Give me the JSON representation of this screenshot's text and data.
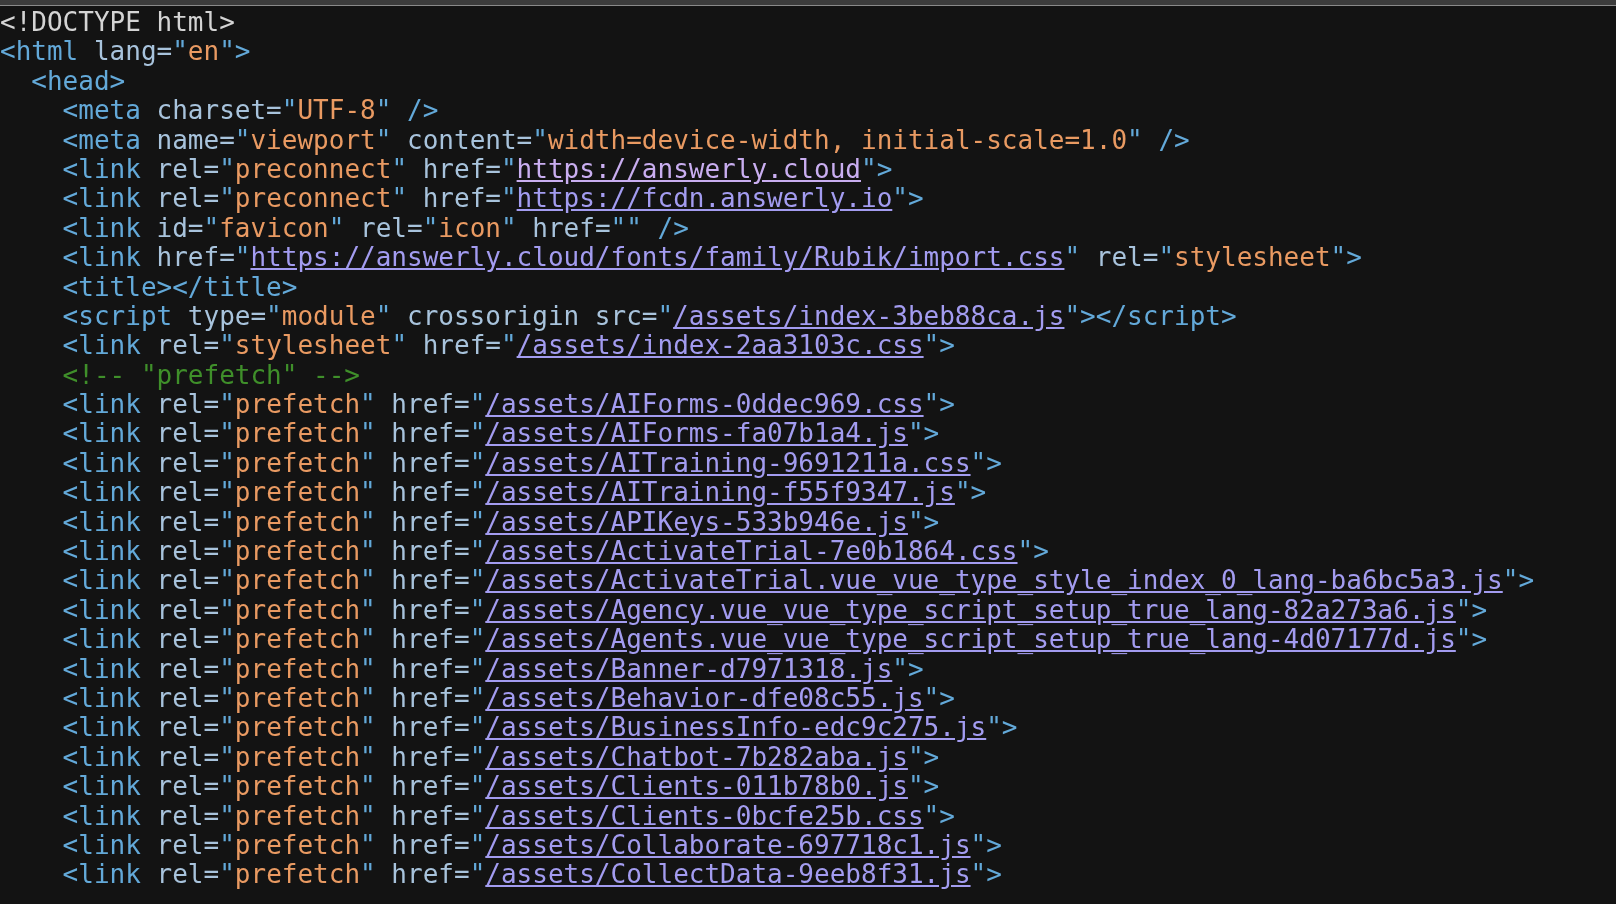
{
  "source_lines": [
    {
      "tokens": [
        {
          "kind": "doctype",
          "text": "<!DOCTYPE html>"
        }
      ]
    },
    {
      "tokens": [
        {
          "kind": "tag",
          "text": "<html"
        },
        {
          "kind": "attr",
          "text": " lang="
        },
        {
          "kind": "punct",
          "text": "\""
        },
        {
          "kind": "value",
          "text": "en"
        },
        {
          "kind": "punct",
          "text": "\">"
        }
      ],
      "children": [
        {
          "tokens": [
            {
              "kind": "tag",
              "text": "<head>"
            }
          ],
          "children": [
            {
              "tokens": [
                {
                  "kind": "tag",
                  "text": "<meta"
                },
                {
                  "kind": "attr",
                  "text": " charset="
                },
                {
                  "kind": "punct",
                  "text": "\""
                },
                {
                  "kind": "value",
                  "text": "UTF-8"
                },
                {
                  "kind": "punct",
                  "text": "\" />"
                }
              ]
            },
            {
              "tokens": [
                {
                  "kind": "tag",
                  "text": "<meta"
                },
                {
                  "kind": "attr",
                  "text": " name="
                },
                {
                  "kind": "punct",
                  "text": "\""
                },
                {
                  "kind": "value",
                  "text": "viewport"
                },
                {
                  "kind": "punct",
                  "text": "\""
                },
                {
                  "kind": "attr",
                  "text": " content="
                },
                {
                  "kind": "punct",
                  "text": "\""
                },
                {
                  "kind": "value",
                  "text": "width=device-width, initial-scale=1.0"
                },
                {
                  "kind": "punct",
                  "text": "\" />"
                }
              ]
            },
            {
              "tokens": [
                {
                  "kind": "tag",
                  "text": "<link"
                },
                {
                  "kind": "attr",
                  "text": " rel="
                },
                {
                  "kind": "punct",
                  "text": "\""
                },
                {
                  "kind": "value",
                  "text": "preconnect"
                },
                {
                  "kind": "punct",
                  "text": "\""
                },
                {
                  "kind": "attr",
                  "text": " href="
                },
                {
                  "kind": "punct",
                  "text": "\""
                },
                {
                  "kind": "link",
                  "text": "https://answerly.cloud",
                  "visited": true
                },
                {
                  "kind": "punct",
                  "text": "\">"
                }
              ]
            },
            {
              "tokens": [
                {
                  "kind": "tag",
                  "text": "<link"
                },
                {
                  "kind": "attr",
                  "text": " rel="
                },
                {
                  "kind": "punct",
                  "text": "\""
                },
                {
                  "kind": "value",
                  "text": "preconnect"
                },
                {
                  "kind": "punct",
                  "text": "\""
                },
                {
                  "kind": "attr",
                  "text": " href="
                },
                {
                  "kind": "punct",
                  "text": "\""
                },
                {
                  "kind": "link",
                  "text": "https://fcdn.answerly.io",
                  "visited": false
                },
                {
                  "kind": "punct",
                  "text": "\">"
                }
              ]
            },
            {
              "tokens": [
                {
                  "kind": "tag",
                  "text": "<link"
                },
                {
                  "kind": "attr",
                  "text": " id="
                },
                {
                  "kind": "punct",
                  "text": "\""
                },
                {
                  "kind": "value",
                  "text": "favicon"
                },
                {
                  "kind": "punct",
                  "text": "\""
                },
                {
                  "kind": "attr",
                  "text": " rel="
                },
                {
                  "kind": "punct",
                  "text": "\""
                },
                {
                  "kind": "value",
                  "text": "icon"
                },
                {
                  "kind": "punct",
                  "text": "\""
                },
                {
                  "kind": "attr",
                  "text": " href="
                },
                {
                  "kind": "punct",
                  "text": "\"\" />"
                }
              ]
            },
            {
              "tokens": [
                {
                  "kind": "tag",
                  "text": "<link"
                },
                {
                  "kind": "attr",
                  "text": " href="
                },
                {
                  "kind": "punct",
                  "text": "\""
                },
                {
                  "kind": "link",
                  "text": "https://answerly.cloud/fonts/family/Rubik/import.css",
                  "visited": false
                },
                {
                  "kind": "punct",
                  "text": "\""
                },
                {
                  "kind": "attr",
                  "text": " rel="
                },
                {
                  "kind": "punct",
                  "text": "\""
                },
                {
                  "kind": "value",
                  "text": "stylesheet"
                },
                {
                  "kind": "punct",
                  "text": "\">"
                }
              ]
            },
            {
              "tokens": [
                {
                  "kind": "tag",
                  "text": "<title></title>"
                }
              ]
            },
            {
              "tokens": [
                {
                  "kind": "tag",
                  "text": "<script"
                },
                {
                  "kind": "attr",
                  "text": " type="
                },
                {
                  "kind": "punct",
                  "text": "\""
                },
                {
                  "kind": "value",
                  "text": "module"
                },
                {
                  "kind": "punct",
                  "text": "\""
                },
                {
                  "kind": "attr",
                  "text": " crossorigin src="
                },
                {
                  "kind": "punct",
                  "text": "\""
                },
                {
                  "kind": "link",
                  "text": "/assets/index-3beb88ca.js",
                  "visited": false
                },
                {
                  "kind": "punct",
                  "text": "\"></script>"
                }
              ]
            },
            {
              "tokens": [
                {
                  "kind": "tag",
                  "text": "<link"
                },
                {
                  "kind": "attr",
                  "text": " rel="
                },
                {
                  "kind": "punct",
                  "text": "\""
                },
                {
                  "kind": "value",
                  "text": "stylesheet"
                },
                {
                  "kind": "punct",
                  "text": "\""
                },
                {
                  "kind": "attr",
                  "text": " href="
                },
                {
                  "kind": "punct",
                  "text": "\""
                },
                {
                  "kind": "link",
                  "text": "/assets/index-2aa3103c.css",
                  "visited": false
                },
                {
                  "kind": "punct",
                  "text": "\">"
                }
              ]
            },
            {
              "tokens": [
                {
                  "kind": "comment",
                  "text": "<!-- \"prefetch\" -->"
                }
              ]
            },
            {
              "tokens": [
                {
                  "kind": "tag",
                  "text": "<link"
                },
                {
                  "kind": "attr",
                  "text": " rel="
                },
                {
                  "kind": "punct",
                  "text": "\""
                },
                {
                  "kind": "value",
                  "text": "prefetch"
                },
                {
                  "kind": "punct",
                  "text": "\""
                },
                {
                  "kind": "attr",
                  "text": " href="
                },
                {
                  "kind": "punct",
                  "text": "\""
                },
                {
                  "kind": "link",
                  "text": "/assets/AIForms-0ddec969.css",
                  "visited": false
                },
                {
                  "kind": "punct",
                  "text": "\">"
                }
              ]
            },
            {
              "tokens": [
                {
                  "kind": "tag",
                  "text": "<link"
                },
                {
                  "kind": "attr",
                  "text": " rel="
                },
                {
                  "kind": "punct",
                  "text": "\""
                },
                {
                  "kind": "value",
                  "text": "prefetch"
                },
                {
                  "kind": "punct",
                  "text": "\""
                },
                {
                  "kind": "attr",
                  "text": " href="
                },
                {
                  "kind": "punct",
                  "text": "\""
                },
                {
                  "kind": "link",
                  "text": "/assets/AIForms-fa07b1a4.js",
                  "visited": false
                },
                {
                  "kind": "punct",
                  "text": "\">"
                }
              ]
            },
            {
              "tokens": [
                {
                  "kind": "tag",
                  "text": "<link"
                },
                {
                  "kind": "attr",
                  "text": " rel="
                },
                {
                  "kind": "punct",
                  "text": "\""
                },
                {
                  "kind": "value",
                  "text": "prefetch"
                },
                {
                  "kind": "punct",
                  "text": "\""
                },
                {
                  "kind": "attr",
                  "text": " href="
                },
                {
                  "kind": "punct",
                  "text": "\""
                },
                {
                  "kind": "link",
                  "text": "/assets/AITraining-9691211a.css",
                  "visited": false
                },
                {
                  "kind": "punct",
                  "text": "\">"
                }
              ]
            },
            {
              "tokens": [
                {
                  "kind": "tag",
                  "text": "<link"
                },
                {
                  "kind": "attr",
                  "text": " rel="
                },
                {
                  "kind": "punct",
                  "text": "\""
                },
                {
                  "kind": "value",
                  "text": "prefetch"
                },
                {
                  "kind": "punct",
                  "text": "\""
                },
                {
                  "kind": "attr",
                  "text": " href="
                },
                {
                  "kind": "punct",
                  "text": "\""
                },
                {
                  "kind": "link",
                  "text": "/assets/AITraining-f55f9347.js",
                  "visited": false
                },
                {
                  "kind": "punct",
                  "text": "\">"
                }
              ]
            },
            {
              "tokens": [
                {
                  "kind": "tag",
                  "text": "<link"
                },
                {
                  "kind": "attr",
                  "text": " rel="
                },
                {
                  "kind": "punct",
                  "text": "\""
                },
                {
                  "kind": "value",
                  "text": "prefetch"
                },
                {
                  "kind": "punct",
                  "text": "\""
                },
                {
                  "kind": "attr",
                  "text": " href="
                },
                {
                  "kind": "punct",
                  "text": "\""
                },
                {
                  "kind": "link",
                  "text": "/assets/APIKeys-533b946e.js",
                  "visited": false
                },
                {
                  "kind": "punct",
                  "text": "\">"
                }
              ]
            },
            {
              "tokens": [
                {
                  "kind": "tag",
                  "text": "<link"
                },
                {
                  "kind": "attr",
                  "text": " rel="
                },
                {
                  "kind": "punct",
                  "text": "\""
                },
                {
                  "kind": "value",
                  "text": "prefetch"
                },
                {
                  "kind": "punct",
                  "text": "\""
                },
                {
                  "kind": "attr",
                  "text": " href="
                },
                {
                  "kind": "punct",
                  "text": "\""
                },
                {
                  "kind": "link",
                  "text": "/assets/ActivateTrial-7e0b1864.css",
                  "visited": false
                },
                {
                  "kind": "punct",
                  "text": "\">"
                }
              ]
            },
            {
              "tokens": [
                {
                  "kind": "tag",
                  "text": "<link"
                },
                {
                  "kind": "attr",
                  "text": " rel="
                },
                {
                  "kind": "punct",
                  "text": "\""
                },
                {
                  "kind": "value",
                  "text": "prefetch"
                },
                {
                  "kind": "punct",
                  "text": "\""
                },
                {
                  "kind": "attr",
                  "text": " href="
                },
                {
                  "kind": "punct",
                  "text": "\""
                },
                {
                  "kind": "link",
                  "text": "/assets/ActivateTrial.vue_vue_type_style_index_0_lang-ba6bc5a3.js",
                  "visited": false
                },
                {
                  "kind": "punct",
                  "text": "\">"
                }
              ]
            },
            {
              "tokens": [
                {
                  "kind": "tag",
                  "text": "<link"
                },
                {
                  "kind": "attr",
                  "text": " rel="
                },
                {
                  "kind": "punct",
                  "text": "\""
                },
                {
                  "kind": "value",
                  "text": "prefetch"
                },
                {
                  "kind": "punct",
                  "text": "\""
                },
                {
                  "kind": "attr",
                  "text": " href="
                },
                {
                  "kind": "punct",
                  "text": "\""
                },
                {
                  "kind": "link",
                  "text": "/assets/Agency.vue_vue_type_script_setup_true_lang-82a273a6.js",
                  "visited": false
                },
                {
                  "kind": "punct",
                  "text": "\">"
                }
              ]
            },
            {
              "tokens": [
                {
                  "kind": "tag",
                  "text": "<link"
                },
                {
                  "kind": "attr",
                  "text": " rel="
                },
                {
                  "kind": "punct",
                  "text": "\""
                },
                {
                  "kind": "value",
                  "text": "prefetch"
                },
                {
                  "kind": "punct",
                  "text": "\""
                },
                {
                  "kind": "attr",
                  "text": " href="
                },
                {
                  "kind": "punct",
                  "text": "\""
                },
                {
                  "kind": "link",
                  "text": "/assets/Agents.vue_vue_type_script_setup_true_lang-4d07177d.js",
                  "visited": false
                },
                {
                  "kind": "punct",
                  "text": "\">"
                }
              ]
            },
            {
              "tokens": [
                {
                  "kind": "tag",
                  "text": "<link"
                },
                {
                  "kind": "attr",
                  "text": " rel="
                },
                {
                  "kind": "punct",
                  "text": "\""
                },
                {
                  "kind": "value",
                  "text": "prefetch"
                },
                {
                  "kind": "punct",
                  "text": "\""
                },
                {
                  "kind": "attr",
                  "text": " href="
                },
                {
                  "kind": "punct",
                  "text": "\""
                },
                {
                  "kind": "link",
                  "text": "/assets/Banner-d7971318.js",
                  "visited": false
                },
                {
                  "kind": "punct",
                  "text": "\">"
                }
              ]
            },
            {
              "tokens": [
                {
                  "kind": "tag",
                  "text": "<link"
                },
                {
                  "kind": "attr",
                  "text": " rel="
                },
                {
                  "kind": "punct",
                  "text": "\""
                },
                {
                  "kind": "value",
                  "text": "prefetch"
                },
                {
                  "kind": "punct",
                  "text": "\""
                },
                {
                  "kind": "attr",
                  "text": " href="
                },
                {
                  "kind": "punct",
                  "text": "\""
                },
                {
                  "kind": "link",
                  "text": "/assets/Behavior-dfe08c55.js",
                  "visited": false
                },
                {
                  "kind": "punct",
                  "text": "\">"
                }
              ]
            },
            {
              "tokens": [
                {
                  "kind": "tag",
                  "text": "<link"
                },
                {
                  "kind": "attr",
                  "text": " rel="
                },
                {
                  "kind": "punct",
                  "text": "\""
                },
                {
                  "kind": "value",
                  "text": "prefetch"
                },
                {
                  "kind": "punct",
                  "text": "\""
                },
                {
                  "kind": "attr",
                  "text": " href="
                },
                {
                  "kind": "punct",
                  "text": "\""
                },
                {
                  "kind": "link",
                  "text": "/assets/BusinessInfo-edc9c275.js",
                  "visited": false
                },
                {
                  "kind": "punct",
                  "text": "\">"
                }
              ]
            },
            {
              "tokens": [
                {
                  "kind": "tag",
                  "text": "<link"
                },
                {
                  "kind": "attr",
                  "text": " rel="
                },
                {
                  "kind": "punct",
                  "text": "\""
                },
                {
                  "kind": "value",
                  "text": "prefetch"
                },
                {
                  "kind": "punct",
                  "text": "\""
                },
                {
                  "kind": "attr",
                  "text": " href="
                },
                {
                  "kind": "punct",
                  "text": "\""
                },
                {
                  "kind": "link",
                  "text": "/assets/Chatbot-7b282aba.js",
                  "visited": false
                },
                {
                  "kind": "punct",
                  "text": "\">"
                }
              ]
            },
            {
              "tokens": [
                {
                  "kind": "tag",
                  "text": "<link"
                },
                {
                  "kind": "attr",
                  "text": " rel="
                },
                {
                  "kind": "punct",
                  "text": "\""
                },
                {
                  "kind": "value",
                  "text": "prefetch"
                },
                {
                  "kind": "punct",
                  "text": "\""
                },
                {
                  "kind": "attr",
                  "text": " href="
                },
                {
                  "kind": "punct",
                  "text": "\""
                },
                {
                  "kind": "link",
                  "text": "/assets/Clients-011b78b0.js",
                  "visited": false
                },
                {
                  "kind": "punct",
                  "text": "\">"
                }
              ]
            },
            {
              "tokens": [
                {
                  "kind": "tag",
                  "text": "<link"
                },
                {
                  "kind": "attr",
                  "text": " rel="
                },
                {
                  "kind": "punct",
                  "text": "\""
                },
                {
                  "kind": "value",
                  "text": "prefetch"
                },
                {
                  "kind": "punct",
                  "text": "\""
                },
                {
                  "kind": "attr",
                  "text": " href="
                },
                {
                  "kind": "punct",
                  "text": "\""
                },
                {
                  "kind": "link",
                  "text": "/assets/Clients-0bcfe25b.css",
                  "visited": false
                },
                {
                  "kind": "punct",
                  "text": "\">"
                }
              ]
            },
            {
              "tokens": [
                {
                  "kind": "tag",
                  "text": "<link"
                },
                {
                  "kind": "attr",
                  "text": " rel="
                },
                {
                  "kind": "punct",
                  "text": "\""
                },
                {
                  "kind": "value",
                  "text": "prefetch"
                },
                {
                  "kind": "punct",
                  "text": "\""
                },
                {
                  "kind": "attr",
                  "text": " href="
                },
                {
                  "kind": "punct",
                  "text": "\""
                },
                {
                  "kind": "link",
                  "text": "/assets/Collaborate-697718c1.js",
                  "visited": false
                },
                {
                  "kind": "punct",
                  "text": "\">"
                }
              ]
            },
            {
              "tokens": [
                {
                  "kind": "tag",
                  "text": "<link"
                },
                {
                  "kind": "attr",
                  "text": " rel="
                },
                {
                  "kind": "punct",
                  "text": "\""
                },
                {
                  "kind": "value",
                  "text": "prefetch"
                },
                {
                  "kind": "punct",
                  "text": "\""
                },
                {
                  "kind": "attr",
                  "text": " href="
                },
                {
                  "kind": "punct",
                  "text": "\""
                },
                {
                  "kind": "link",
                  "text": "/assets/CollectData-9eeb8f31.js",
                  "visited": false
                },
                {
                  "kind": "punct",
                  "text": "\">"
                }
              ]
            }
          ]
        }
      ]
    }
  ]
}
